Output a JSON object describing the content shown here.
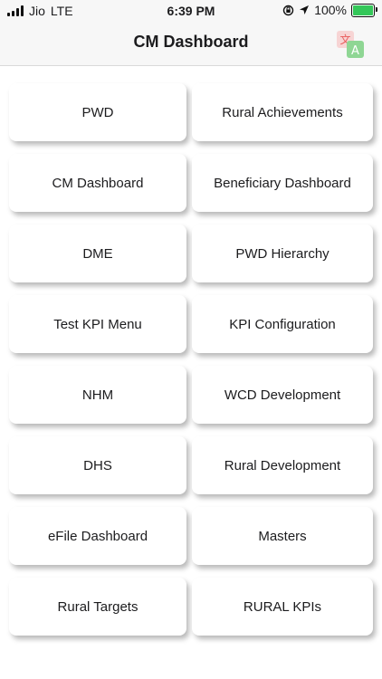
{
  "status_bar": {
    "carrier": "Jio",
    "network": "LTE",
    "time": "6:39 PM",
    "battery": "100%",
    "icons": [
      "signal-icon",
      "location-icon",
      "orientation-lock-icon",
      "battery-icon"
    ]
  },
  "header": {
    "title": "CM Dashboard",
    "right_icon": "translate-icon"
  },
  "menu": {
    "items": [
      {
        "label": "PWD"
      },
      {
        "label": "Rural Achievements"
      },
      {
        "label": "CM Dashboard"
      },
      {
        "label": "Beneficiary Dashboard"
      },
      {
        "label": "DME"
      },
      {
        "label": "PWD Hierarchy"
      },
      {
        "label": "Test KPI Menu"
      },
      {
        "label": "KPI Configuration"
      },
      {
        "label": "NHM"
      },
      {
        "label": "WCD Development"
      },
      {
        "label": "DHS"
      },
      {
        "label": "Rural Development"
      },
      {
        "label": "eFile Dashboard"
      },
      {
        "label": "Masters"
      },
      {
        "label": "Rural Targets"
      },
      {
        "label": "RURAL KPIs"
      }
    ]
  },
  "colors": {
    "bar_background": "#f7f7f7",
    "tile_background": "#ffffff",
    "battery_fill": "#34c759",
    "translate_red": "#e85a5a",
    "translate_green": "#8fd694"
  }
}
